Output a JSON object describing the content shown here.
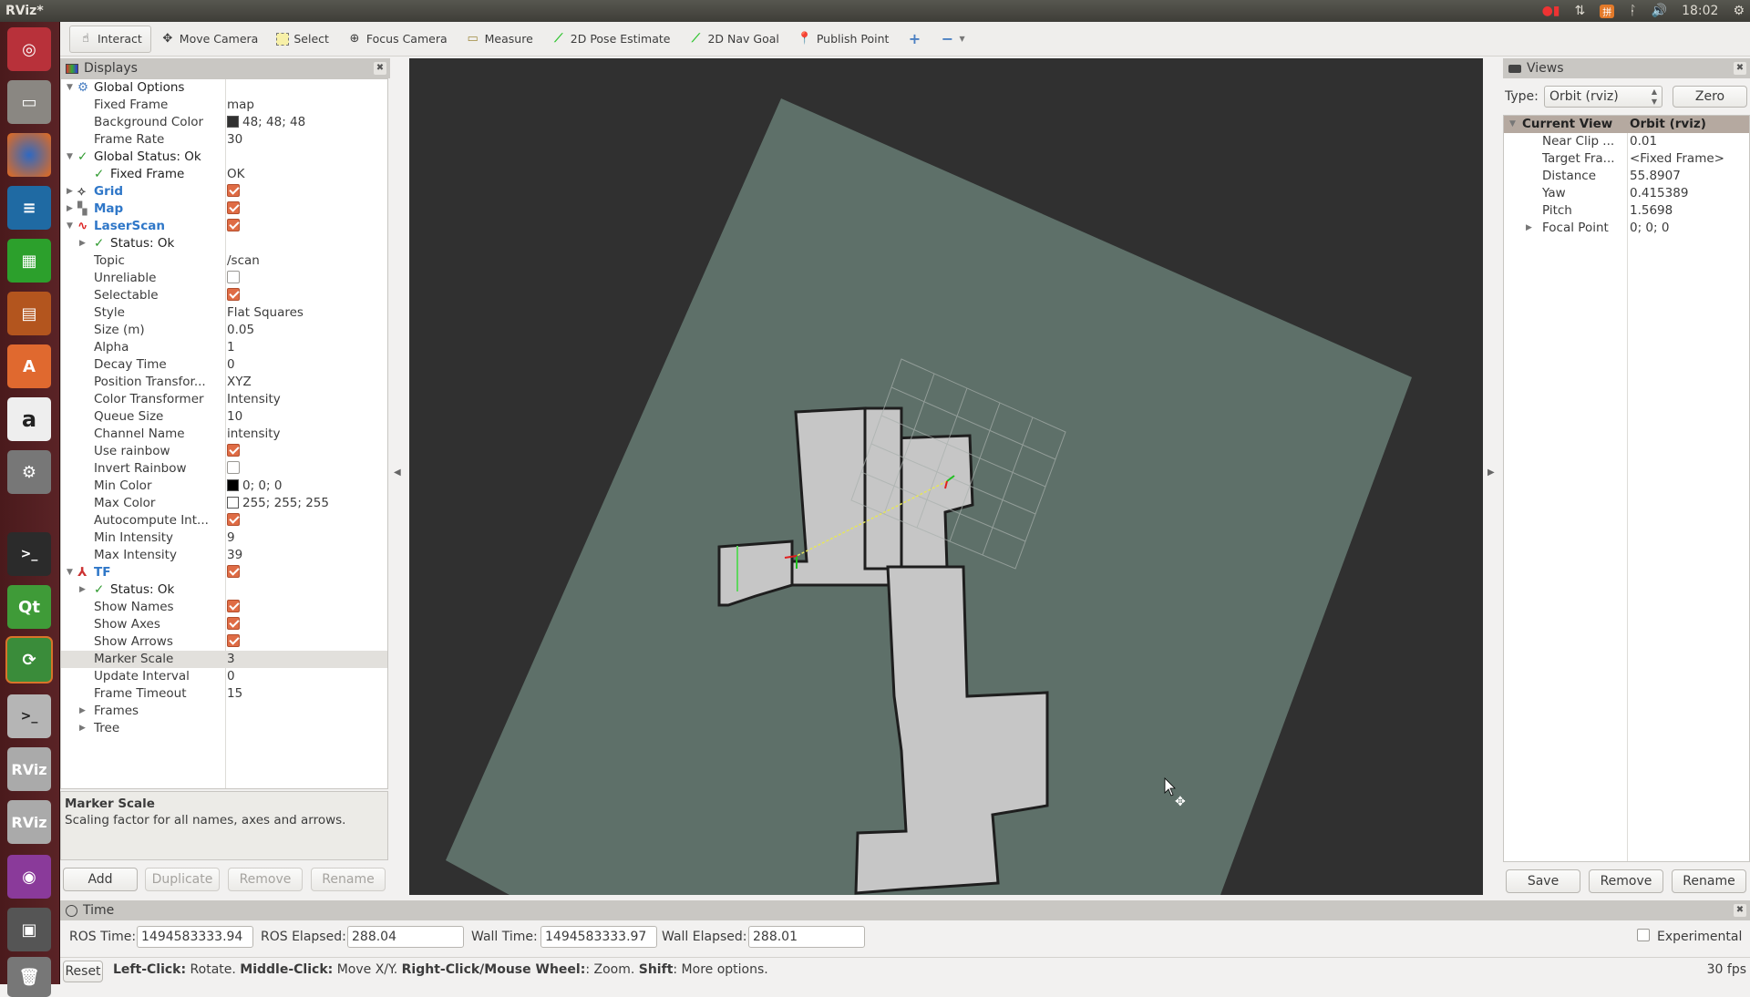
{
  "window": {
    "title": "RViz*"
  },
  "tray": {
    "clock": "18:02",
    "icons": [
      "record-icon",
      "network-icon",
      "input-method-icon",
      "bluetooth-icon",
      "volume-icon",
      "power-icon"
    ]
  },
  "launcher": {
    "apps": [
      "ubuntu-dash",
      "files",
      "firefox",
      "libreoffice-writer",
      "libreoffice-calc",
      "libreoffice-impress",
      "software-center",
      "amazon",
      "system-settings",
      "terminal",
      "qt-creator",
      "software-updater",
      "terminal-2",
      "rviz",
      "rviz-2",
      "video-recorder",
      "save-disk",
      "trash"
    ]
  },
  "toolbar": {
    "tools": [
      {
        "label": "Interact",
        "icon": "hand-pointer-icon",
        "active": true
      },
      {
        "label": "Move Camera",
        "icon": "move-camera-icon"
      },
      {
        "label": "Select",
        "icon": "select-box-icon"
      },
      {
        "label": "Focus Camera",
        "icon": "focus-camera-icon"
      },
      {
        "label": "Measure",
        "icon": "ruler-icon"
      },
      {
        "label": "2D Pose Estimate",
        "icon": "green-arrow-icon"
      },
      {
        "label": "2D Nav Goal",
        "icon": "green-arrow-icon"
      },
      {
        "label": "Publish Point",
        "icon": "map-pin-icon"
      }
    ]
  },
  "displays": {
    "title": "Displays",
    "rows": [
      {
        "indent": 0,
        "arrow": "down",
        "icon": "gear",
        "key": "Global Options",
        "val": ""
      },
      {
        "indent": 1,
        "key": "Fixed Frame",
        "val": "map"
      },
      {
        "indent": 1,
        "key": "Background Color",
        "val": "48; 48; 48",
        "swatch": "#303030"
      },
      {
        "indent": 1,
        "key": "Frame Rate",
        "val": "30"
      },
      {
        "indent": 0,
        "arrow": "down",
        "icon": "check",
        "key": "Global Status: Ok",
        "val": ""
      },
      {
        "indent": 1,
        "icon": "check",
        "key": "Fixed Frame",
        "val": "OK"
      },
      {
        "indent": 0,
        "arrow": "right",
        "icon": "grid",
        "key": "Grid",
        "val": "",
        "check": true,
        "blue": true
      },
      {
        "indent": 0,
        "arrow": "right",
        "icon": "map",
        "key": "Map",
        "val": "",
        "check": true,
        "blue": true
      },
      {
        "indent": 0,
        "arrow": "down",
        "icon": "laser",
        "key": "LaserScan",
        "val": "",
        "check": true,
        "blue": true
      },
      {
        "indent": 1,
        "arrow": "right",
        "icon": "check",
        "key": "Status: Ok",
        "val": ""
      },
      {
        "indent": 1,
        "key": "Topic",
        "val": "/scan"
      },
      {
        "indent": 1,
        "key": "Unreliable",
        "val": "",
        "check": false
      },
      {
        "indent": 1,
        "key": "Selectable",
        "val": "",
        "check": true
      },
      {
        "indent": 1,
        "key": "Style",
        "val": "Flat Squares"
      },
      {
        "indent": 1,
        "key": "Size (m)",
        "val": "0.05"
      },
      {
        "indent": 1,
        "key": "Alpha",
        "val": "1"
      },
      {
        "indent": 1,
        "key": "Decay Time",
        "val": "0"
      },
      {
        "indent": 1,
        "key": "Position Transfor...",
        "val": "XYZ"
      },
      {
        "indent": 1,
        "key": "Color Transformer",
        "val": "Intensity"
      },
      {
        "indent": 1,
        "key": "Queue Size",
        "val": "10"
      },
      {
        "indent": 1,
        "key": "Channel Name",
        "val": "intensity"
      },
      {
        "indent": 1,
        "key": "Use rainbow",
        "val": "",
        "check": true
      },
      {
        "indent": 1,
        "key": "Invert Rainbow",
        "val": "",
        "check": false
      },
      {
        "indent": 1,
        "key": "Min Color",
        "val": "0; 0; 0",
        "swatch": "#000000"
      },
      {
        "indent": 1,
        "key": "Max Color",
        "val": "255; 255; 255",
        "swatch": "#ffffff"
      },
      {
        "indent": 1,
        "key": "Autocompute Int...",
        "val": "",
        "check": true
      },
      {
        "indent": 1,
        "key": "Min Intensity",
        "val": "9"
      },
      {
        "indent": 1,
        "key": "Max Intensity",
        "val": "39"
      },
      {
        "indent": 0,
        "arrow": "down",
        "icon": "tf",
        "key": "TF",
        "val": "",
        "check": true,
        "blue": true
      },
      {
        "indent": 1,
        "arrow": "right",
        "icon": "check",
        "key": "Status: Ok",
        "val": ""
      },
      {
        "indent": 1,
        "key": "Show Names",
        "val": "",
        "check": true
      },
      {
        "indent": 1,
        "key": "Show Axes",
        "val": "",
        "check": true
      },
      {
        "indent": 1,
        "key": "Show Arrows",
        "val": "",
        "check": true
      },
      {
        "indent": 1,
        "key": "Marker Scale",
        "val": "3",
        "selected": true
      },
      {
        "indent": 1,
        "key": "Update Interval",
        "val": "0"
      },
      {
        "indent": 1,
        "key": "Frame Timeout",
        "val": "15"
      },
      {
        "indent": 1,
        "arrow": "right",
        "key": "Frames",
        "val": ""
      },
      {
        "indent": 1,
        "arrow": "right",
        "key": "Tree",
        "val": ""
      }
    ],
    "description": {
      "title": "Marker Scale",
      "text": "Scaling factor for all names, axes and arrows."
    },
    "buttons": {
      "add": "Add",
      "duplicate": "Duplicate",
      "remove": "Remove",
      "rename": "Rename"
    }
  },
  "views": {
    "title": "Views",
    "type_label": "Type:",
    "type_value": "Orbit (rviz)",
    "zero": "Zero",
    "header": {
      "key": "Current View",
      "val": "Orbit (rviz)"
    },
    "rows": [
      {
        "key": "Near Clip ...",
        "val": "0.01"
      },
      {
        "key": "Target Fra...",
        "val": "<Fixed Frame>"
      },
      {
        "key": "Distance",
        "val": "55.8907"
      },
      {
        "key": "Yaw",
        "val": "0.415389"
      },
      {
        "key": "Pitch",
        "val": "1.5698"
      },
      {
        "key": "Focal Point",
        "val": "0; 0; 0",
        "arrow": true
      }
    ],
    "buttons": {
      "save": "Save",
      "remove": "Remove",
      "rename": "Rename"
    }
  },
  "time": {
    "title": "Time",
    "ros_time_label": "ROS Time:",
    "ros_time": "1494583333.94",
    "ros_elapsed_label": "ROS Elapsed:",
    "ros_elapsed": "288.04",
    "wall_time_label": "Wall Time:",
    "wall_time": "1494583333.97",
    "wall_elapsed_label": "Wall Elapsed:",
    "wall_elapsed": "288.01",
    "experimental": "Experimental"
  },
  "status": {
    "reset": "Reset",
    "hint": [
      {
        "b": "Left-Click:",
        "t": " Rotate. "
      },
      {
        "b": "Middle-Click:",
        "t": " Move X/Y. "
      },
      {
        "b": "Right-Click/Mouse Wheel:",
        "t": ": Zoom. "
      },
      {
        "b": "Shift",
        "t": ": More options."
      }
    ],
    "fps": "30 fps"
  },
  "colors": {
    "background": "#303030",
    "map_unknown": "#5e7069",
    "map_free": "#c6c6c6",
    "check_accent": "#df6c45",
    "display_name": "#2f77c8"
  }
}
